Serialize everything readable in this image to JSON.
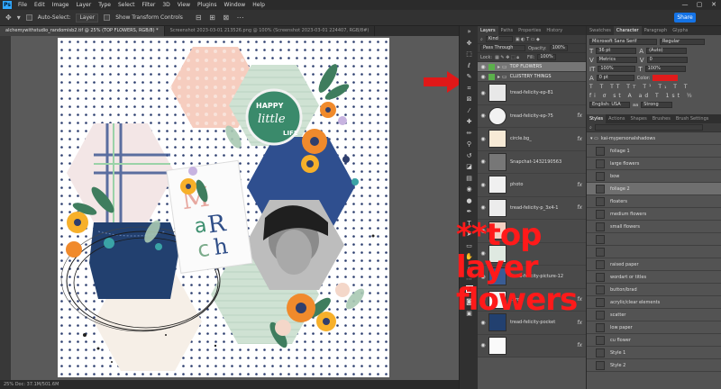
{
  "menubar": {
    "items": [
      "File",
      "Edit",
      "Image",
      "Layer",
      "Type",
      "Select",
      "Filter",
      "3D",
      "View",
      "Plugins",
      "Window",
      "Help"
    ]
  },
  "window_controls": [
    "—",
    "▢",
    "✕"
  ],
  "options": {
    "auto_select": "Auto-Select:",
    "auto_select_value": "Layer",
    "show_transform": "Show Transform Controls",
    "share": "Share"
  },
  "tabs": [
    {
      "label": "alchemywithstudio_randomisb2.tif @ 25% (TOP FLOWERS, RGB/8) *",
      "active": true
    },
    {
      "label": "Screenshot 2023-03-01 213526.png @ 100% (Screenshot 2023-03-01 224407, RGB/8#)",
      "active": false
    }
  ],
  "status": "25%   Doc: 37.1M/501.6M",
  "canvas": {
    "badge_line1": "HAPPY",
    "badge_line2": "little",
    "badge_line3": "LIFE",
    "letter_m": "M",
    "letter_a": "a",
    "letter_r": "R",
    "letter_c": "c",
    "letter_h": "h"
  },
  "layers_panel": {
    "tabs": [
      "Layers",
      "Paths",
      "Properties",
      "History"
    ],
    "kind": "Kind",
    "blend": "Pass Through",
    "opacity_label": "Opacity:",
    "opacity": "100%",
    "lock_label": "Lock:",
    "fill_label": "Fill:",
    "fill": "100%",
    "groups": [
      {
        "name": "TOP FLOWERS",
        "selected": true,
        "color": "#5bb04b"
      },
      {
        "name": "CLUSTERY THINGS",
        "selected": false,
        "color": "#5bb04b"
      }
    ],
    "layers": [
      {
        "name": "tread-felicity-ep-81",
        "fx": ""
      },
      {
        "name": "tread-felicity-ep-75",
        "fx": "fx"
      },
      {
        "name": "circle.bg_",
        "fx": "fx"
      },
      {
        "name": "Snapchat-1432190563",
        "fx": ""
      },
      {
        "name": "photo",
        "fx": "fx"
      },
      {
        "name": "tread-felicity-p_3x4-1",
        "fx": "fx"
      },
      {
        "name": "",
        "fx": ""
      },
      {
        "name": "",
        "fx": ""
      },
      {
        "name": "tread-felicity-picture-12",
        "fx": ""
      },
      {
        "name": "card",
        "fx": "fx"
      },
      {
        "name": "tread-felicity-pocket",
        "fx": "fx"
      },
      {
        "name": "",
        "fx": "fx"
      }
    ]
  },
  "character_panel": {
    "tabs": [
      "Swatches",
      "Character",
      "Paragraph",
      "Glyphs"
    ],
    "font": "Microsoft Sans Serif",
    "style": "Regular",
    "size": "36 pt",
    "leading": "(Auto)",
    "kerning": "Metrics",
    "tracking": "0",
    "vscale": "100%",
    "hscale": "100%",
    "baseline": "0 pt",
    "color_label": "Color:",
    "color": "#e11b1b",
    "language": "English: USA",
    "aa": "Strong"
  },
  "styles_panel": {
    "tabs": [
      "Styles",
      "Actions",
      "Shapes",
      "Brushes",
      "Brush Settings"
    ],
    "folder": "kai-mypersonalshadows",
    "items": [
      "foliage 1",
      "large flowers",
      "bow",
      "foliage 2",
      "floaters",
      "medium flowers",
      "small flowers",
      "",
      "",
      "raised paper",
      "wordart or titles",
      "button/brad",
      "acrylic/clear elements",
      "scatter",
      "low paper",
      "cu flower",
      "Style 1",
      "Style 2"
    ],
    "selected": "foliage 2"
  },
  "overlay_text": {
    "line1": "**top layer",
    "line2": "flowers"
  }
}
